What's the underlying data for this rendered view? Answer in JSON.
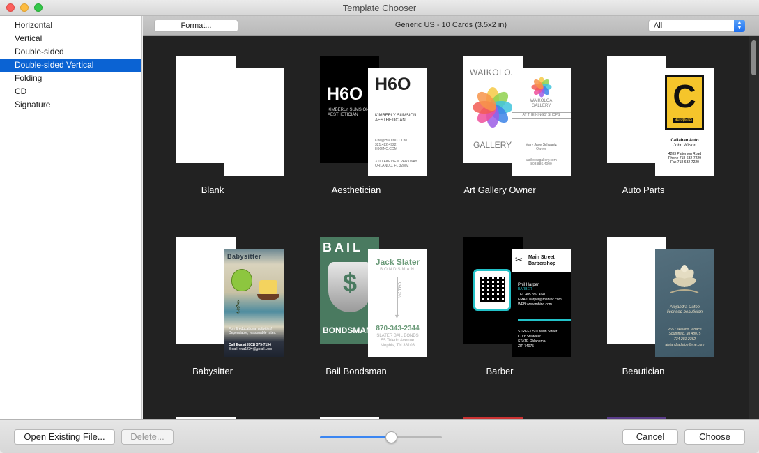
{
  "window": {
    "title": "Template Chooser"
  },
  "sidebar": {
    "items": [
      {
        "label": "Horizontal",
        "selected": false
      },
      {
        "label": "Vertical",
        "selected": false
      },
      {
        "label": "Double-sided",
        "selected": false
      },
      {
        "label": "Double-sided Vertical",
        "selected": true
      },
      {
        "label": "Folding",
        "selected": false
      },
      {
        "label": "CD",
        "selected": false
      },
      {
        "label": "Signature",
        "selected": false
      }
    ]
  },
  "toolbar": {
    "format_label": "Format...",
    "caption": "Generic US - 10 Cards (3.5x2 in)",
    "filter_value": "All"
  },
  "templates": [
    {
      "name": "Blank"
    },
    {
      "name": "Aesthetician",
      "card": {
        "logo": "H6O",
        "person": "KIMBERLY SUMSION",
        "role": "AESTHETICIAN",
        "email": "KIM@H6OINC.COM",
        "phone": "321.422.4922",
        "web": "H6OINC.COM",
        "address1": "310 LAKEVIEW PARKWAY",
        "address2": "ORLANDO, FL 32802"
      }
    },
    {
      "name": "Art Gallery Owner",
      "card": {
        "word1": "WAIKOLOA",
        "word2": "GALLERY",
        "tagline": "AT THE KINGS' SHOPS",
        "person": "Mary Jane Schwartz",
        "role": "Owner",
        "web": "waikoloagallery.com",
        "phone": "808.886.4000"
      }
    },
    {
      "name": "Auto Parts",
      "card": {
        "logo_letter": "C",
        "logo_word": "autoparts",
        "company": "Callahan Auto",
        "person": "John Wilson",
        "address": "4283 Patterson Road",
        "phone": "Phone 718-632-7229",
        "fax": "Fax 718-632-7220"
      }
    },
    {
      "name": "Babysitter",
      "card": {
        "header": "Babysitter",
        "bullet1": "Fun & educational activities!",
        "bullet2": "Dependable, reasonable rates.",
        "call": "Call Eva at (801) 375-7134",
        "email": "Email: eva1234@gmail.com"
      }
    },
    {
      "name": "Bail Bondsman",
      "card": {
        "back_top": "BAIL",
        "back_bottom": "BONDSMAN",
        "person": "Jack Slater",
        "role": "BONDSMAN",
        "side": "CALL 24/7",
        "phone": "870-343-2344",
        "company": "SLATER BAIL BONDS",
        "address1": "55 Toledo Avenue",
        "address2": "Mophis, TN 38103"
      }
    },
    {
      "name": "Barber",
      "card": {
        "company1": "Main Street",
        "company2": "Barbershop",
        "person": "Phil Harper",
        "role": "BARBER",
        "tel": "TEL 405.392.4940",
        "email": "EMAIL harper@mabinc.com",
        "web": "WEB www.mbinc.com",
        "street": "STREET 501 Main Street",
        "city": "CITY Stillwater",
        "state": "STATE Oklahoma",
        "zip": "ZIP 74075"
      }
    },
    {
      "name": "Beautician",
      "card": {
        "person": "Alejandra Dafoe",
        "role": "licensed beautician",
        "address1": "265 Lakeland Terrace",
        "address2": "Southfield, MI 48075",
        "phone": "734-281-2362",
        "email": "alejandradafoe@me.com"
      }
    }
  ],
  "footer": {
    "open_label": "Open Existing File...",
    "delete_label": "Delete...",
    "cancel_label": "Cancel",
    "choose_label": "Choose",
    "zoom_fraction": 0.58
  },
  "colors": {
    "selection": "#0b63d3",
    "gallery_bg": "#222222",
    "slider_fill": "#3b86f2"
  }
}
